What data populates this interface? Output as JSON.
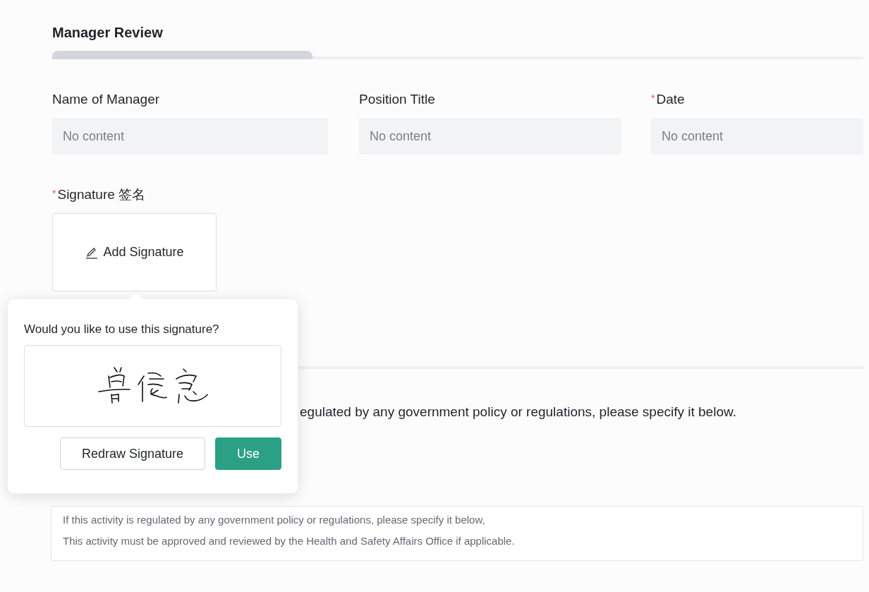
{
  "section": {
    "title": "Manager Review"
  },
  "fields": [
    {
      "label": "Name of Manager",
      "placeholder": "No content"
    },
    {
      "label": "Position Title",
      "placeholder": "No content"
    },
    {
      "label": "Date",
      "required_mark": "*",
      "placeholder": "No content"
    }
  ],
  "signature": {
    "label": "Signature 签名",
    "required_mark": "*",
    "button": "Add Signature"
  },
  "question_text": "egulated by any government policy or regulations, please specify it below.",
  "notes": {
    "lines": [
      "If this activity is regulated by any government policy or regulations, please specify it below,",
      "This activity must be approved and reviewed by the Health and Safety Affairs Office if applicable."
    ]
  },
  "popover": {
    "prompt": "Would you like to use this signature?",
    "buttons": [
      {
        "label": "Redraw Signature",
        "kind": "secondary"
      },
      {
        "label": "Use",
        "kind": "primary"
      }
    ]
  }
}
